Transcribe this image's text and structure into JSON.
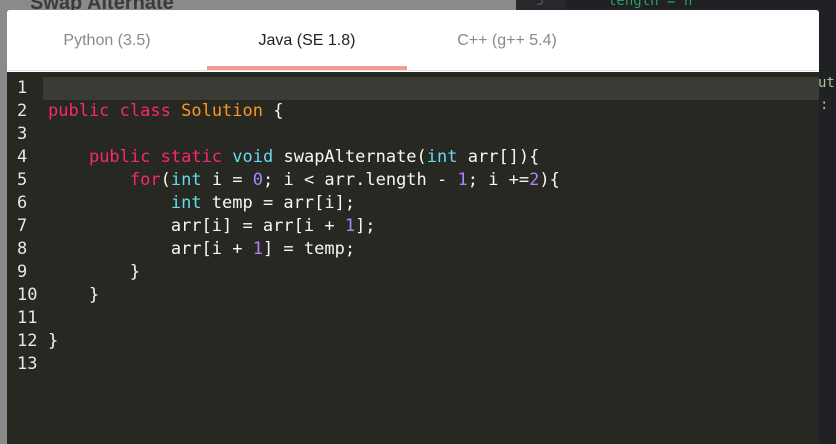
{
  "background": {
    "page_title": "Swap Alternate",
    "right_panel_line_number": "5",
    "right_panel_code": "length = n",
    "right_edge_fragment_1": "ut",
    "right_edge_fragment_2": ":"
  },
  "tabs": [
    {
      "label": "Python (3.5)",
      "active": false
    },
    {
      "label": "Java (SE 1.8)",
      "active": true
    },
    {
      "label": "C++ (g++ 5.4)",
      "active": false
    }
  ],
  "editor": {
    "theme_colors": {
      "background": "#272822",
      "keyword": "#f92672",
      "type": "#66d9ef",
      "class_name": "#fd971f",
      "number": "#ae81ff",
      "text": "#f8f8f2"
    },
    "line_numbers": [
      "1",
      "2",
      "3",
      "4",
      "5",
      "6",
      "7",
      "8",
      "9",
      "10",
      "11",
      "12",
      "13"
    ],
    "lines": [
      [],
      [
        {
          "t": "public",
          "c": "kw"
        },
        {
          "t": " "
        },
        {
          "t": "class",
          "c": "kw"
        },
        {
          "t": " "
        },
        {
          "t": "Solution",
          "c": "cls"
        },
        {
          "t": " {"
        }
      ],
      [],
      [
        {
          "t": "    "
        },
        {
          "t": "public",
          "c": "kw"
        },
        {
          "t": " "
        },
        {
          "t": "static",
          "c": "kw"
        },
        {
          "t": " "
        },
        {
          "t": "void",
          "c": "ty"
        },
        {
          "t": " swapAlternate("
        },
        {
          "t": "int",
          "c": "ty"
        },
        {
          "t": " arr[]){"
        }
      ],
      [
        {
          "t": "        "
        },
        {
          "t": "for",
          "c": "kw"
        },
        {
          "t": "("
        },
        {
          "t": "int",
          "c": "ty"
        },
        {
          "t": " i = "
        },
        {
          "t": "0",
          "c": "num"
        },
        {
          "t": "; i < arr.length - "
        },
        {
          "t": "1",
          "c": "num"
        },
        {
          "t": "; i +="
        },
        {
          "t": "2",
          "c": "num"
        },
        {
          "t": "){"
        }
      ],
      [
        {
          "t": "            "
        },
        {
          "t": "int",
          "c": "ty"
        },
        {
          "t": " temp = arr[i];"
        }
      ],
      [
        {
          "t": "            arr[i] = arr[i + "
        },
        {
          "t": "1",
          "c": "num"
        },
        {
          "t": "];"
        }
      ],
      [
        {
          "t": "            arr[i + "
        },
        {
          "t": "1",
          "c": "num"
        },
        {
          "t": "] = temp;"
        }
      ],
      [
        {
          "t": "        }"
        }
      ],
      [
        {
          "t": "    }"
        }
      ],
      [],
      [
        {
          "t": "}"
        }
      ],
      []
    ]
  }
}
